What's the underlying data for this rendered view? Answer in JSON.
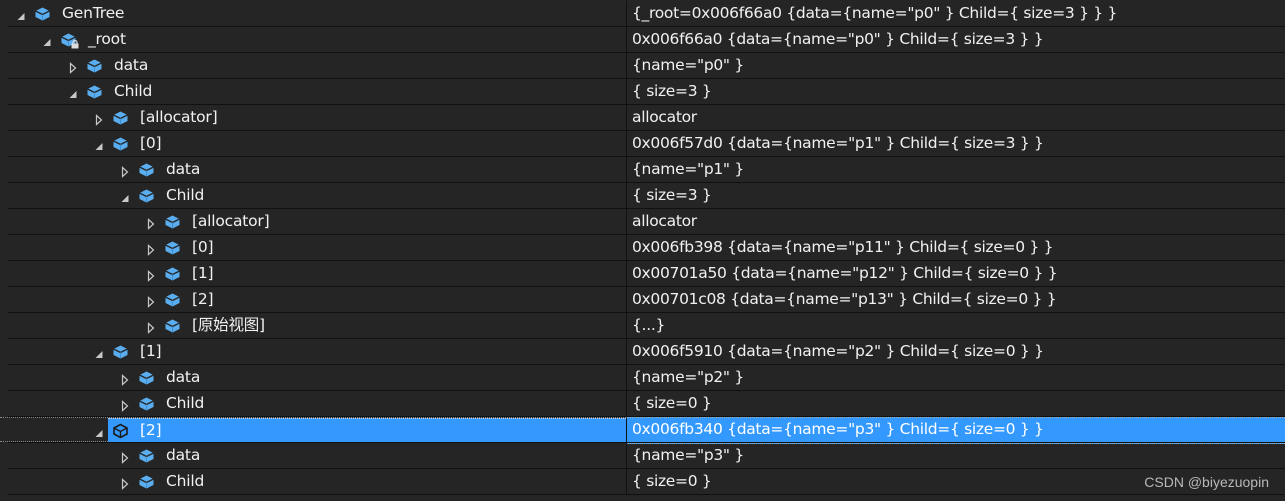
{
  "window": "Watch",
  "colors": {
    "background": "#252526",
    "selection": "#3399ff",
    "icon": "#5aaeef",
    "text": "#f1f1f1"
  },
  "rows": [
    {
      "level": 0,
      "expanded": true,
      "name": "GenTree",
      "value": "{_root=0x006f66a0 {data={name=\"p0\" } Child={ size=3 } } }",
      "icon": "field-cube-icon"
    },
    {
      "level": 1,
      "expanded": true,
      "name": "_root",
      "value": "0x006f66a0 {data={name=\"p0\" } Child={ size=3 } }",
      "icon": "private-field-cube-icon"
    },
    {
      "level": 2,
      "expanded": false,
      "name": "data",
      "value": "{name=\"p0\" }",
      "icon": "field-cube-icon"
    },
    {
      "level": 2,
      "expanded": true,
      "name": "Child",
      "value": "{ size=3 }",
      "icon": "field-cube-icon"
    },
    {
      "level": 3,
      "expanded": false,
      "name": "[allocator]",
      "value": "allocator",
      "icon": "field-cube-icon"
    },
    {
      "level": 3,
      "expanded": true,
      "name": "[0]",
      "value": "0x006f57d0 {data={name=\"p1\" } Child={ size=3 } }",
      "icon": "field-cube-icon"
    },
    {
      "level": 4,
      "expanded": false,
      "name": "data",
      "value": "{name=\"p1\" }",
      "icon": "field-cube-icon"
    },
    {
      "level": 4,
      "expanded": true,
      "name": "Child",
      "value": "{ size=3 }",
      "icon": "field-cube-icon"
    },
    {
      "level": 5,
      "expanded": false,
      "name": "[allocator]",
      "value": "allocator",
      "icon": "field-cube-icon"
    },
    {
      "level": 5,
      "expanded": false,
      "name": "[0]",
      "value": "0x006fb398 {data={name=\"p11\" } Child={ size=0 } }",
      "icon": "field-cube-icon"
    },
    {
      "level": 5,
      "expanded": false,
      "name": "[1]",
      "value": "0x00701a50 {data={name=\"p12\" } Child={ size=0 } }",
      "icon": "field-cube-icon"
    },
    {
      "level": 5,
      "expanded": false,
      "name": "[2]",
      "value": "0x00701c08 {data={name=\"p13\" } Child={ size=0 } }",
      "icon": "field-cube-icon"
    },
    {
      "level": 5,
      "expanded": false,
      "name": "[原始视图]",
      "value": "{...}",
      "icon": "field-cube-icon"
    },
    {
      "level": 3,
      "expanded": true,
      "name": "[1]",
      "value": "0x006f5910 {data={name=\"p2\" } Child={ size=0 } }",
      "icon": "field-cube-icon"
    },
    {
      "level": 4,
      "expanded": false,
      "name": "data",
      "value": "{name=\"p2\" }",
      "icon": "field-cube-icon"
    },
    {
      "level": 4,
      "expanded": false,
      "name": "Child",
      "value": "{ size=0 }",
      "icon": "field-cube-icon"
    },
    {
      "level": 3,
      "expanded": true,
      "name": "[2]",
      "value": "0x006fb340 {data={name=\"p3\" } Child={ size=0 } }",
      "icon": "field-cube-icon",
      "selected": true
    },
    {
      "level": 4,
      "expanded": false,
      "name": "data",
      "value": "{name=\"p3\" }",
      "icon": "field-cube-icon"
    },
    {
      "level": 4,
      "expanded": false,
      "name": "Child",
      "value": "{ size=0 }",
      "icon": "field-cube-icon"
    }
  ],
  "watermark": "CSDN @biyezuopin"
}
